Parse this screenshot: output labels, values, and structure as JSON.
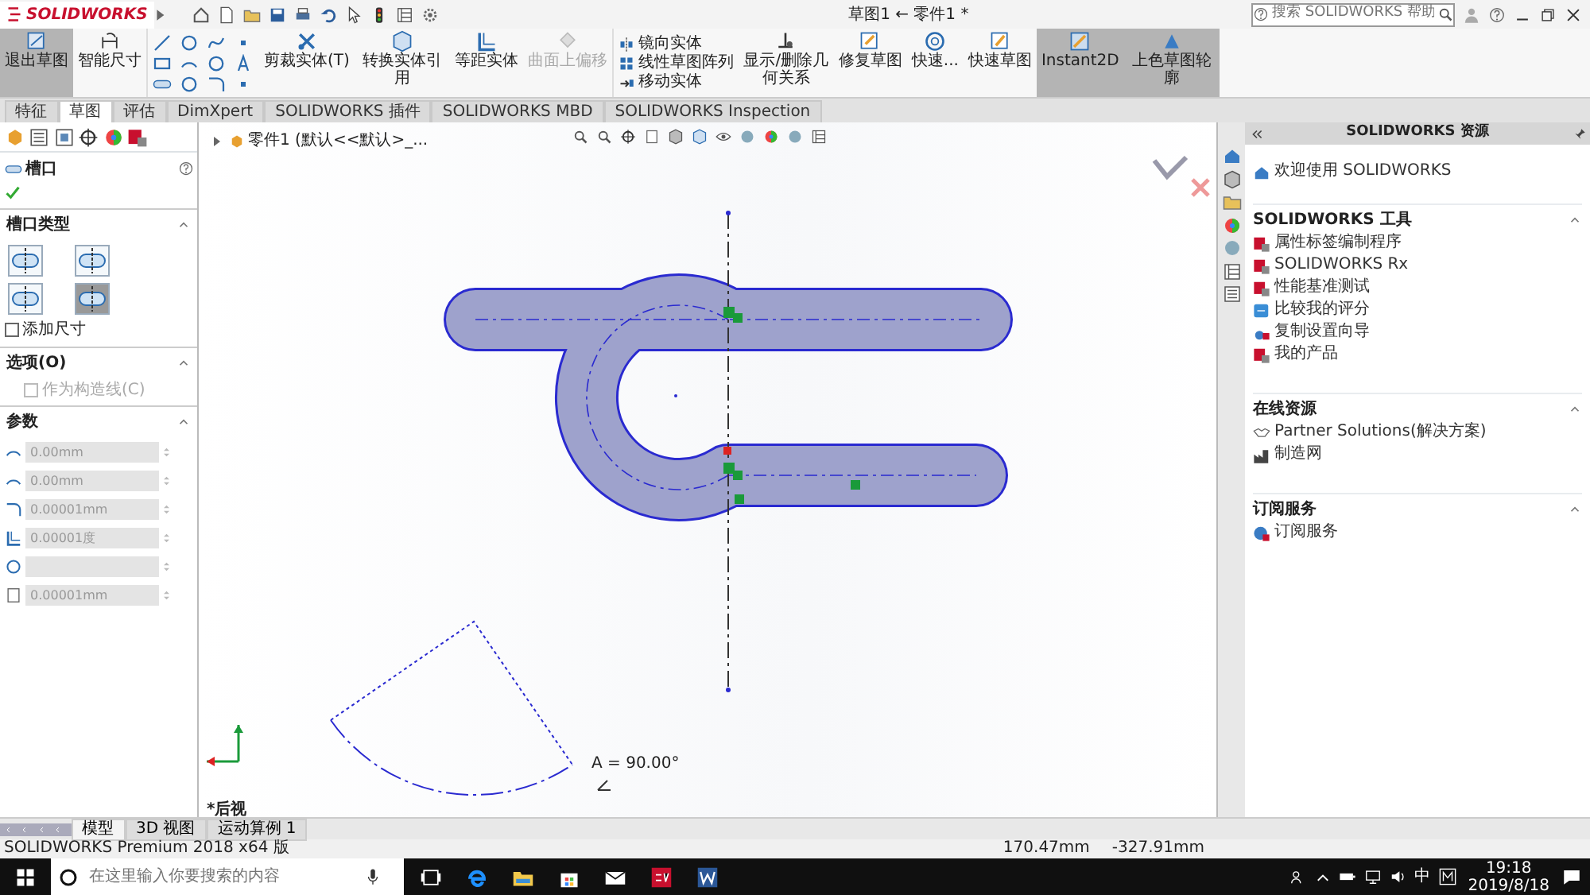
{
  "app_logo": "SOLIDWORKS",
  "window": {
    "title": "草图1 ← 零件1 *"
  },
  "search": {
    "placeholder": "搜索 SOLIDWORKS 帮助"
  },
  "ribbon": [
    {
      "kind": "large",
      "label": "退出草图",
      "selected": true,
      "disabled": false
    },
    {
      "kind": "large",
      "label": "智能尺寸",
      "selected": false,
      "disabled": false
    },
    {
      "kind": "tools"
    },
    {
      "kind": "large",
      "label": "剪裁实体(T)",
      "selected": false,
      "disabled": false
    },
    {
      "kind": "large",
      "label": "转换实体引用",
      "selected": false,
      "disabled": false
    },
    {
      "kind": "large",
      "label": "等距实体",
      "selected": false,
      "disabled": false
    },
    {
      "kind": "large",
      "label": "曲面上偏移",
      "selected": false,
      "disabled": true
    },
    {
      "kind": "stack",
      "items": [
        "镜向实体",
        "线性草图阵列",
        "移动实体"
      ]
    },
    {
      "kind": "large",
      "label": "显示/删除几何关系",
      "selected": false,
      "disabled": false
    },
    {
      "kind": "large",
      "label": "修复草图",
      "selected": false,
      "disabled": false
    },
    {
      "kind": "large",
      "label": "快速...",
      "selected": false,
      "disabled": false
    },
    {
      "kind": "large",
      "label": "快速草图",
      "selected": false,
      "disabled": false
    },
    {
      "kind": "large",
      "label": "Instant2D",
      "selected": true,
      "disabled": false
    },
    {
      "kind": "large",
      "label": "上色草图轮廓",
      "selected": true,
      "disabled": false
    }
  ],
  "command_tabs": [
    {
      "label": "特征",
      "selected": false
    },
    {
      "label": "草图",
      "selected": true
    },
    {
      "label": "评估",
      "selected": false
    },
    {
      "label": "DimXpert",
      "selected": false
    },
    {
      "label": "SOLIDWORKS 插件",
      "selected": false
    },
    {
      "label": "SOLIDWORKS MBD",
      "selected": false
    },
    {
      "label": "SOLIDWORKS Inspection",
      "selected": false
    }
  ],
  "property_manager": {
    "title": "槽口",
    "slot_type": {
      "title": "槽口类型",
      "expanded": true,
      "options": [
        {
          "selected": false
        },
        {
          "selected": false
        },
        {
          "selected": false
        },
        {
          "selected": true
        }
      ],
      "add_dimensions": {
        "label": "添加尺寸",
        "checked": false
      }
    },
    "options": {
      "title": "选项(O)",
      "expanded": true,
      "construction": {
        "label": "作为构造线(C)",
        "checked": false,
        "disabled": true
      }
    },
    "parameters": {
      "title": "参数",
      "expanded": true,
      "fields": [
        {
          "value": "0.00mm",
          "disabled": true
        },
        {
          "value": "0.00mm",
          "disabled": true
        },
        {
          "value": "0.00001mm",
          "disabled": true
        },
        {
          "value": "0.00001度",
          "disabled": true
        },
        {
          "disabled": true
        },
        {
          "value": "0.00001mm",
          "disabled": true
        }
      ]
    }
  },
  "feature_tree": {
    "label": "零件1 (默认<<默认>_..."
  },
  "canvas": {
    "angle_label": "A = 90.00°",
    "view_label": "*后视"
  },
  "model_tabs": [
    {
      "label": "模型",
      "selected": true
    },
    {
      "label": "3D 视图",
      "selected": false
    },
    {
      "label": "运动算例 1",
      "selected": false
    }
  ],
  "status_bar": {
    "product": "SOLIDWORKS Premium 2018 x64 版",
    "x": "170.47mm",
    "y": "-327.91mm"
  },
  "resources": {
    "title": "SOLIDWORKS 资源",
    "welcome": "欢迎使用 SOLIDWORKS",
    "sections": [
      {
        "title": "SOLIDWORKS 工具",
        "expanded": true,
        "items": [
          "属性标签编制程序",
          "SOLIDWORKS Rx",
          "性能基准测试",
          "比较我的评分",
          "复制设置向导",
          "我的产品"
        ]
      },
      {
        "title": "在线资源",
        "expanded": true,
        "items": [
          "Partner Solutions(解决方案)",
          "制造网"
        ]
      },
      {
        "title": "订阅服务",
        "expanded": true,
        "items": [
          "订阅服务"
        ]
      }
    ]
  },
  "taskbar": {
    "search_placeholder": "在这里输入你要搜索的内容",
    "ime": "中",
    "time": "19:18",
    "date": "2019/8/18"
  }
}
